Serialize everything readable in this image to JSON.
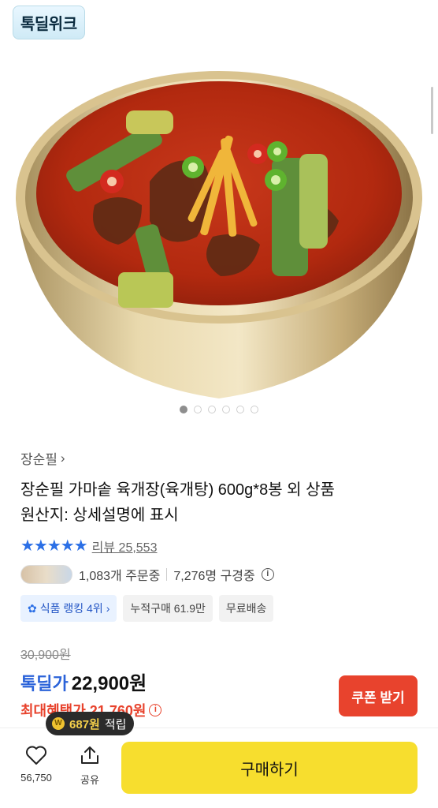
{
  "hero": {
    "badge": "톡딜위크",
    "image_icon": "bowl-of-yukgaejang-image",
    "dots_count": 6,
    "active_dot_index": 0
  },
  "product": {
    "brand": "장순필",
    "brand_chevron": "›",
    "title_line1": "장순필 가마솥 육개장(육개탕) 600g*8봉 외 상품",
    "title_line2": "원산지: 상세설명에 표시",
    "stars": "★★★★★",
    "review_label": "리뷰 25,553",
    "rating_fraction": 0.95,
    "orders": "1,083개 주문중",
    "watching": "7,276명 구경중",
    "tags": {
      "ranking": "식품 랭킹 4위",
      "ranking_chevron": "›",
      "cumulative": "누적구매 61.9만",
      "shipping": "무료배송"
    }
  },
  "price": {
    "original": "30,900원",
    "deal_label": "톡딜가",
    "deal_price": "22,900원",
    "max_benefit": "최대혜택가 21,760원",
    "coupon_button": "쿠폰 받기"
  },
  "bottom_bar": {
    "reward_coin": "W",
    "reward_amount": "687원",
    "reward_suffix": "적립",
    "like_count": "56,750",
    "share_label": "공유",
    "buy_label": "구매하기"
  },
  "colors": {
    "accent_blue": "#2b63d9",
    "sale_red": "#e8432d",
    "buy_yellow": "#f7de2e"
  }
}
